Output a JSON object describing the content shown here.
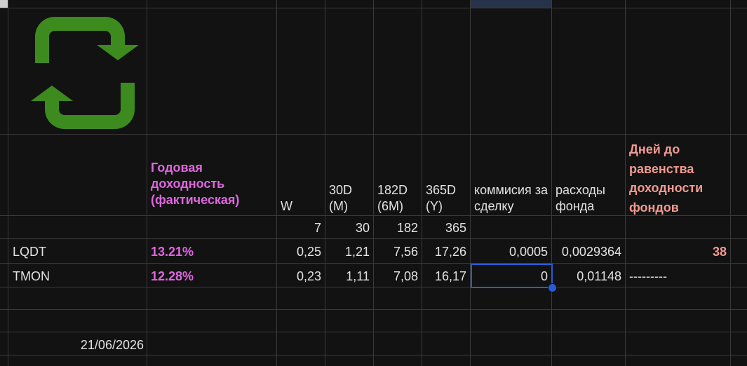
{
  "header_row": {
    "annual_yield": "Годовая доходность (фактическая)",
    "w": "W",
    "d30": "30D (M)",
    "d182": "182D (6M)",
    "d365": "365D (Y)",
    "commission": "коммисия за сделку",
    "fund_expenses": "расходы фонда",
    "days_to_parity": "Дней до равенства доходности фондов"
  },
  "period_days": {
    "w": "7",
    "d30": "30",
    "d182": "182",
    "d365": "365"
  },
  "rows": [
    {
      "ticker": "LQDT",
      "yield": "13.21%",
      "w": "0,25",
      "d30": "1,21",
      "d182": "7,56",
      "d365": "17,26",
      "commission": "0,0005",
      "expenses": "0,0029364",
      "days": "38"
    },
    {
      "ticker": "TMON",
      "yield": "12.28%",
      "w": "0,23",
      "d30": "1,11",
      "d182": "7,08",
      "d365": "16,17",
      "commission": "0",
      "expenses": "0,01148",
      "days": "---------"
    }
  ],
  "date_cell": "21/06/2026",
  "icons": {
    "logo": "green-refresh-cycle-icon"
  },
  "colors": {
    "background": "#121212",
    "gridline": "#3a3a3a",
    "pink": "#e066e0",
    "salmon": "#f19a92",
    "selection": "#2a5bd6",
    "logo": "#3d8a1f"
  }
}
